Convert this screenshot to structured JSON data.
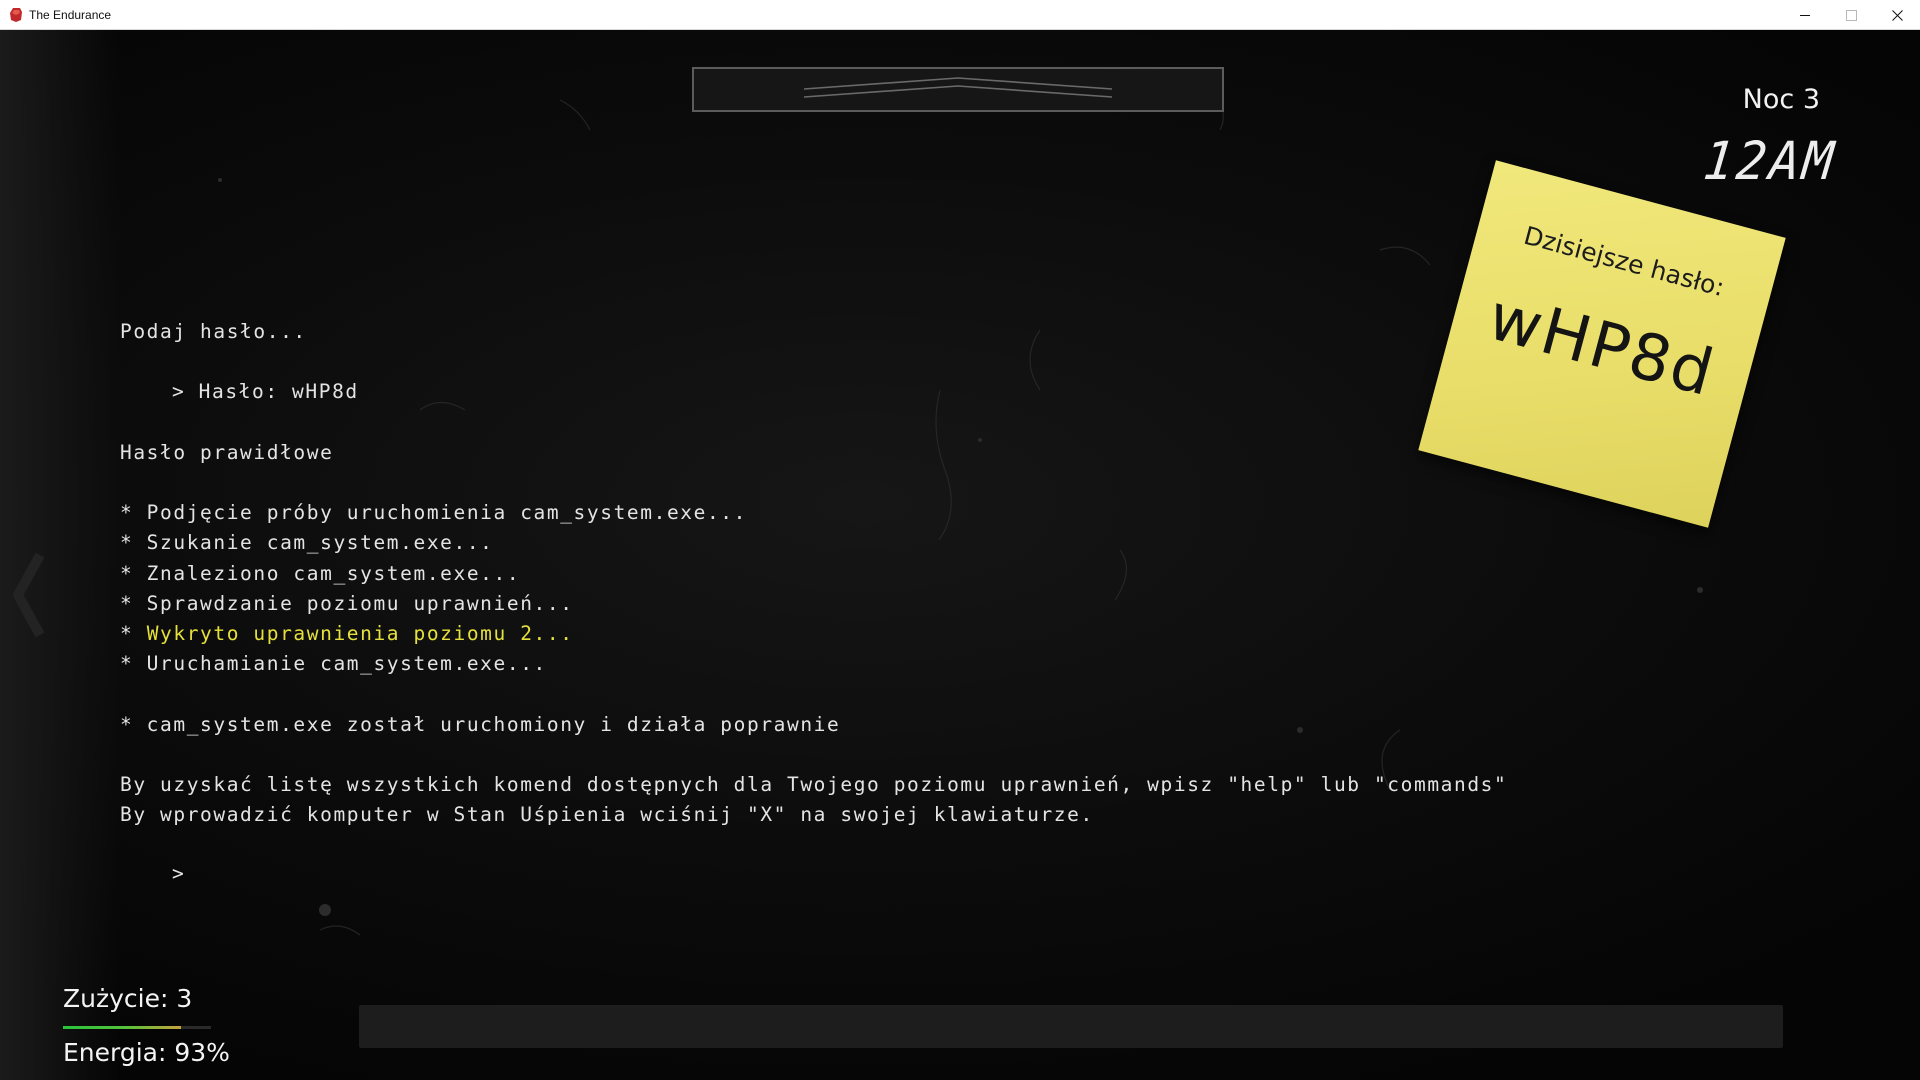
{
  "window": {
    "title": "The Endurance",
    "controls": {
      "minimize": "minimize",
      "maximize": "maximize",
      "close": "✕"
    }
  },
  "hud": {
    "night": "Noc 3",
    "clock": "12AM"
  },
  "sticky_note": {
    "title": "Dzisiejsze hasło:",
    "password": "wHP8d"
  },
  "terminal": {
    "lines": [
      {
        "text": "Podaj hasło...",
        "style": "normal"
      },
      {
        "text": "> Hasło: wHP8d",
        "style": "indent"
      },
      {
        "text": "Hasło prawidłowe",
        "style": "normal"
      },
      {
        "text": "* Podjęcie próby uruchomienia cam_system.exe...",
        "style": "normal"
      },
      {
        "text": "* Szukanie cam_system.exe...",
        "style": "normal"
      },
      {
        "text": "* Znaleziono cam_system.exe...",
        "style": "normal"
      },
      {
        "text": "* Sprawdzanie poziomu uprawnień...",
        "style": "normal"
      },
      {
        "text": "* ",
        "highlight": "Wykryto uprawnienia poziomu 2...",
        "style": "highlight"
      },
      {
        "text": "* Uruchamianie cam_system.exe...",
        "style": "normal"
      },
      {
        "text": "* cam_system.exe został uruchomiony i działa poprawnie",
        "style": "normal"
      },
      {
        "text": "By uzyskać listę wszystkich komend dostępnych dla Twojego poziomu uprawnień, wpisz \"help\" lub \"commands\"",
        "style": "normal"
      },
      {
        "text": "By wprowadzić komputer w Stan Uśpienia wciśnij \"X\" na swojej klawiaturze.",
        "style": "normal"
      }
    ],
    "prompt": ">",
    "highlight_color": "#e6e03c"
  },
  "status": {
    "usage_label": "Zużycie: 3",
    "usage_fraction": 0.8,
    "energy_label": "Energia: 93%",
    "energy_percent": 93
  },
  "colors": {
    "text": "#e4e4e4",
    "sticky": "#ece26e",
    "usage_bar": "#28c43a"
  }
}
